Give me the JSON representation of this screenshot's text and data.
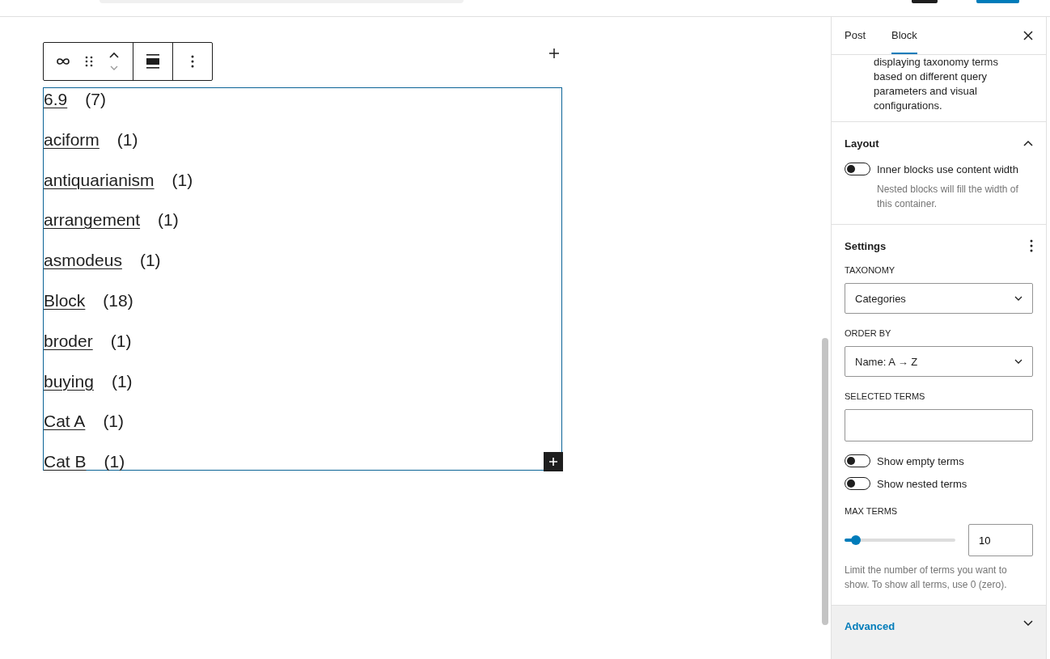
{
  "block_toolbar": {
    "buttons": [
      {
        "kind": "link"
      },
      {
        "kind": "drag"
      },
      {
        "kind": "move"
      },
      {
        "kind": "align"
      },
      {
        "kind": "more"
      }
    ]
  },
  "terms": [
    {
      "name": "6.9",
      "count": "(7)"
    },
    {
      "name": "aciform",
      "count": "(1)"
    },
    {
      "name": "antiquarianism",
      "count": "(1)"
    },
    {
      "name": "arrangement",
      "count": "(1)"
    },
    {
      "name": "asmodeus",
      "count": "(1)"
    },
    {
      "name": "Block",
      "count": "(18)"
    },
    {
      "name": "broder",
      "count": "(1)"
    },
    {
      "name": "buying",
      "count": "(1)"
    },
    {
      "name": "Cat A",
      "count": "(1)"
    },
    {
      "name": "Cat B",
      "count": "(1)"
    }
  ],
  "sidebar": {
    "tabs": [
      {
        "label": "Post",
        "selected": false
      },
      {
        "label": "Block",
        "selected": true
      }
    ],
    "description": "displaying taxonomy terms based on different query parameters and visual configurations.",
    "layout": {
      "title": "Layout",
      "expanded": true,
      "toggle": {
        "label": "Inner blocks use content width",
        "on": false,
        "help": "Nested blocks will fill the width of this container."
      }
    },
    "settings": {
      "title": "Settings",
      "taxonomy": {
        "label": "TAXONOMY",
        "value": "Categories"
      },
      "order_by": {
        "label": "ORDER BY",
        "value": "Name: A → Z"
      },
      "selected_terms": {
        "label": "SELECTED TERMS"
      },
      "toggles": [
        {
          "label": "Show empty terms",
          "on": false
        },
        {
          "label": "Show nested terms",
          "on": false
        }
      ],
      "max_terms": {
        "label": "MAX TERMS",
        "level": 0.1,
        "value": "10",
        "help": "Limit the number of terms you want to show. To show all terms, use 0 (zero)."
      }
    },
    "advanced": {
      "title": "Advanced",
      "expanded": false
    }
  }
}
